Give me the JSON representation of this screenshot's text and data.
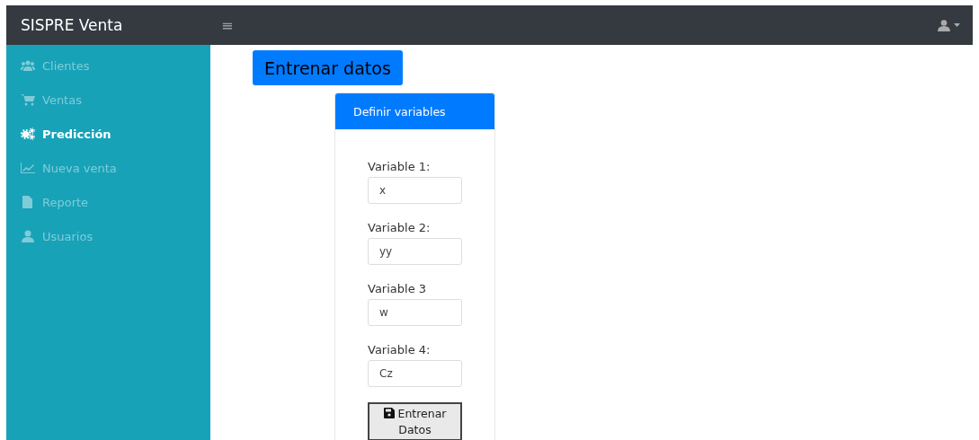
{
  "navbar": {
    "brand": "SISPRE Venta",
    "menu_icon": "≡"
  },
  "sidebar": {
    "items": [
      {
        "label": "Clientes",
        "kind": "users",
        "selected": false
      },
      {
        "label": "Ventas",
        "kind": "cart",
        "selected": false
      },
      {
        "label": "Predicción",
        "kind": "gears",
        "selected": true
      },
      {
        "label": "Nueva venta",
        "kind": "chart",
        "selected": false
      },
      {
        "label": "Reporte",
        "kind": "file",
        "selected": false
      },
      {
        "label": "Usuarios",
        "kind": "user",
        "selected": false
      }
    ]
  },
  "page_button": "Entrenar datos",
  "card": {
    "header": "Definir variables",
    "fields": [
      {
        "label": "Variable 1:",
        "value": "x"
      },
      {
        "label": "Variable 2:",
        "value": "yy"
      },
      {
        "label": "Variable 3",
        "value": "w"
      },
      {
        "label": "Variable 4:",
        "value": "Cz"
      }
    ],
    "submit": "Entrenar Datos"
  }
}
